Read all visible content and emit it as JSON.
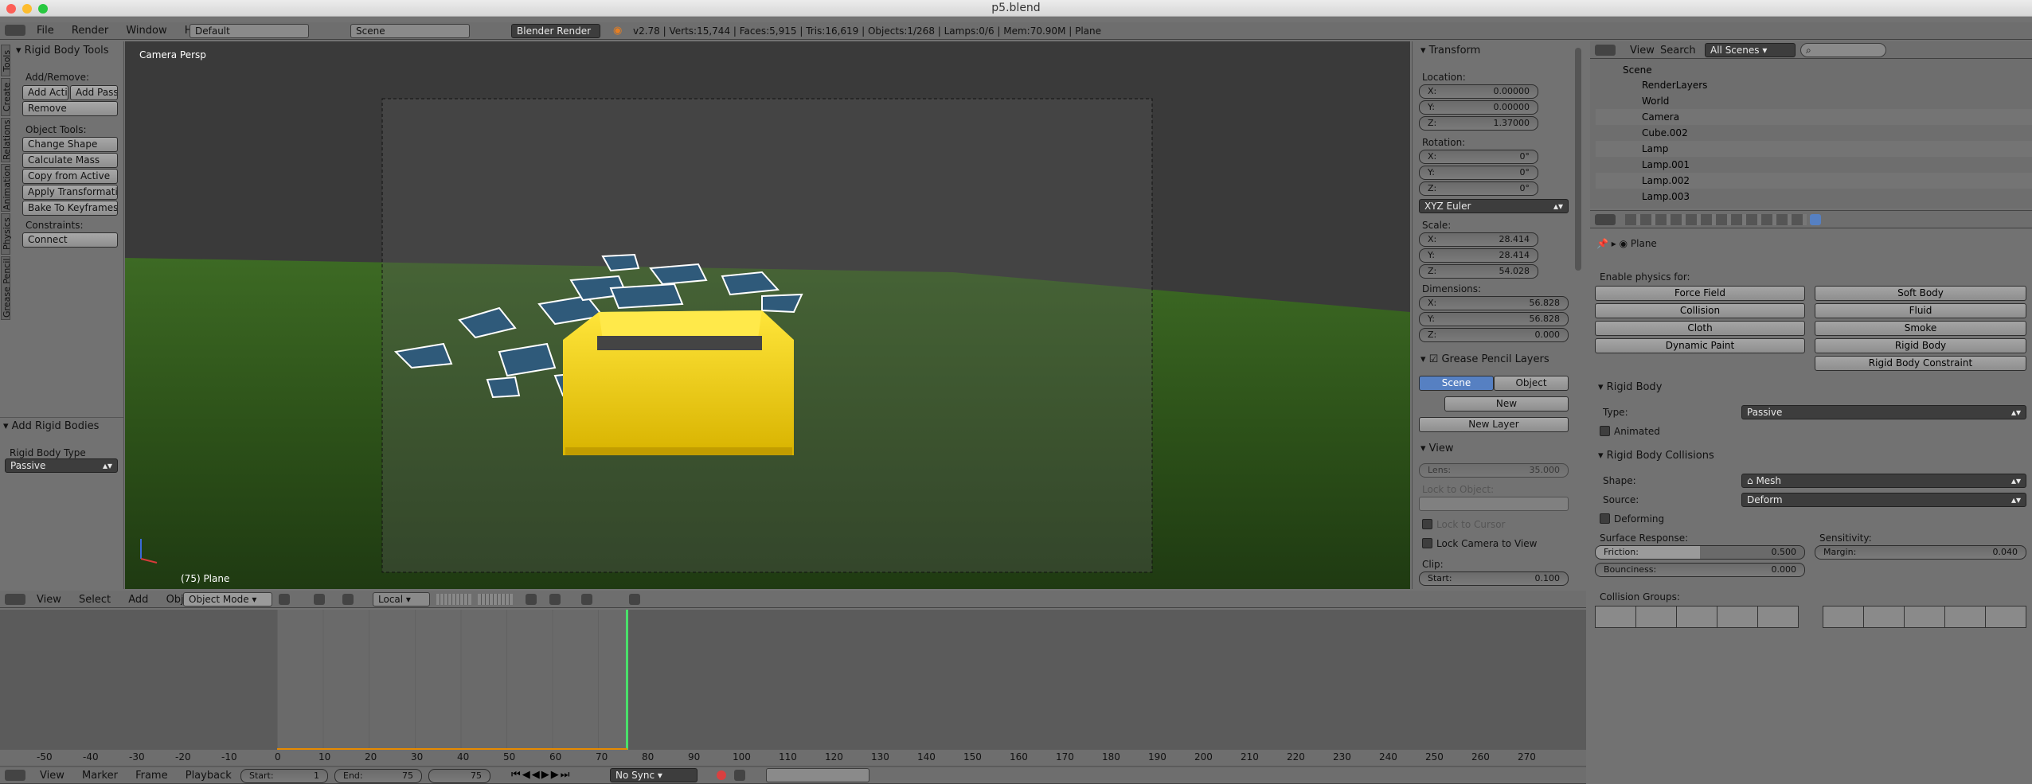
{
  "window": {
    "title": "p5.blend"
  },
  "top_header": {
    "menus": [
      "File",
      "Render",
      "Window",
      "Help"
    ],
    "layout": "Default",
    "scene": "Scene",
    "engine": "Blender Render",
    "stats": "v2.78 | Verts:15,744 | Faces:5,915 | Tris:16,619 | Objects:1/268 | Lamps:0/6 | Mem:70.90M | Plane"
  },
  "tool_shelf": {
    "tabs": [
      "Tools",
      "Create",
      "Relations",
      "Animation",
      "Physics",
      "Grease Pencil"
    ],
    "title": "Rigid Body Tools",
    "add_remove_label": "Add/Remove:",
    "add_active": "Add Activ",
    "add_passive": "Add Passiv",
    "remove": "Remove",
    "object_tools_label": "Object Tools:",
    "change_shape": "Change Shape",
    "calculate_mass": "Calculate Mass",
    "copy_from_active": "Copy from Active",
    "apply_transformation": "Apply Transformation",
    "bake_to_keyframes": "Bake To Keyframes",
    "constraints_label": "Constraints:",
    "connect": "Connect",
    "add_rigid_bodies": "Add Rigid Bodies",
    "rigid_body_type_label": "Rigid Body Type",
    "rigid_body_type": "Passive"
  },
  "viewport": {
    "camera_label": "Camera Persp",
    "object_label": "(75) Plane"
  },
  "n_panel": {
    "transform": "Transform",
    "location": "Location:",
    "loc": [
      {
        "axis": "X:",
        "value": "0.00000"
      },
      {
        "axis": "Y:",
        "value": "0.00000"
      },
      {
        "axis": "Z:",
        "value": "1.37000"
      }
    ],
    "rotation": "Rotation:",
    "rot": [
      {
        "axis": "X:",
        "value": "0°"
      },
      {
        "axis": "Y:",
        "value": "0°"
      },
      {
        "axis": "Z:",
        "value": "0°"
      }
    ],
    "rot_mode": "XYZ Euler",
    "scale": "Scale:",
    "scl": [
      {
        "axis": "X:",
        "value": "28.414"
      },
      {
        "axis": "Y:",
        "value": "28.414"
      },
      {
        "axis": "Z:",
        "value": "54.028"
      }
    ],
    "dimensions": "Dimensions:",
    "dim": [
      {
        "axis": "X:",
        "value": "56.828"
      },
      {
        "axis": "Y:",
        "value": "56.828"
      },
      {
        "axis": "Z:",
        "value": "0.000"
      }
    ],
    "gp_layers": "Grease Pencil Layers",
    "gp_scene": "Scene",
    "gp_object": "Object",
    "gp_new": "New",
    "gp_new_layer": "New Layer",
    "view": "View",
    "lens_label": "Lens:",
    "lens_value": "35.000",
    "lock_to_object": "Lock to Object:",
    "lock_to_cursor": "Lock to Cursor",
    "lock_camera": "Lock Camera to View",
    "clip": "Clip:",
    "clip_start_label": "Start:",
    "clip_start": "0.100"
  },
  "view3d_header": {
    "menus": [
      "View",
      "Select",
      "Add",
      "Object"
    ],
    "mode": "Object Mode",
    "orientation": "Local"
  },
  "timeline": {
    "ticks": [
      "-50",
      "-40",
      "-30",
      "-20",
      "-10",
      "0",
      "10",
      "20",
      "30",
      "40",
      "50",
      "60",
      "70",
      "80",
      "90",
      "100",
      "110",
      "120",
      "130",
      "140",
      "150",
      "160",
      "170",
      "180",
      "190",
      "200",
      "210",
      "220",
      "230",
      "240",
      "250",
      "260",
      "270"
    ],
    "menus": [
      "View",
      "Marker",
      "Frame",
      "Playback"
    ],
    "start_label": "Start:",
    "start": "1",
    "end_label": "End:",
    "end": "75",
    "current": "75",
    "sync": "No Sync",
    "current_frame": 75
  },
  "outliner": {
    "menus": [
      "View",
      "Search"
    ],
    "filter": "All Scenes",
    "items": [
      "Scene",
      "RenderLayers",
      "World",
      "Camera",
      "Cube.002",
      "Lamp",
      "Lamp.001",
      "Lamp.002",
      "Lamp.003"
    ]
  },
  "properties": {
    "object": "Plane",
    "enable_physics": "Enable physics for:",
    "physics_buttons": [
      "Force Field",
      "Soft Body",
      "Collision",
      "Fluid",
      "Cloth",
      "Smoke",
      "Dynamic Paint",
      "Rigid Body",
      "",
      "Rigid Body Constraint"
    ],
    "rigid_body": "Rigid Body",
    "type_label": "Type:",
    "type": "Passive",
    "animated": "Animated",
    "collisions": "Rigid Body Collisions",
    "shape_label": "Shape:",
    "shape": "Mesh",
    "source_label": "Source:",
    "source": "Deform",
    "deforming": "Deforming",
    "surface_response": "Surface Response:",
    "sensitivity": "Sensitivity:",
    "friction_label": "Friction:",
    "friction": "0.500",
    "margin_label": "Margin:",
    "margin": "0.040",
    "bounciness_label": "Bounciness:",
    "bounciness": "0.000",
    "collision_groups": "Collision Groups:"
  }
}
